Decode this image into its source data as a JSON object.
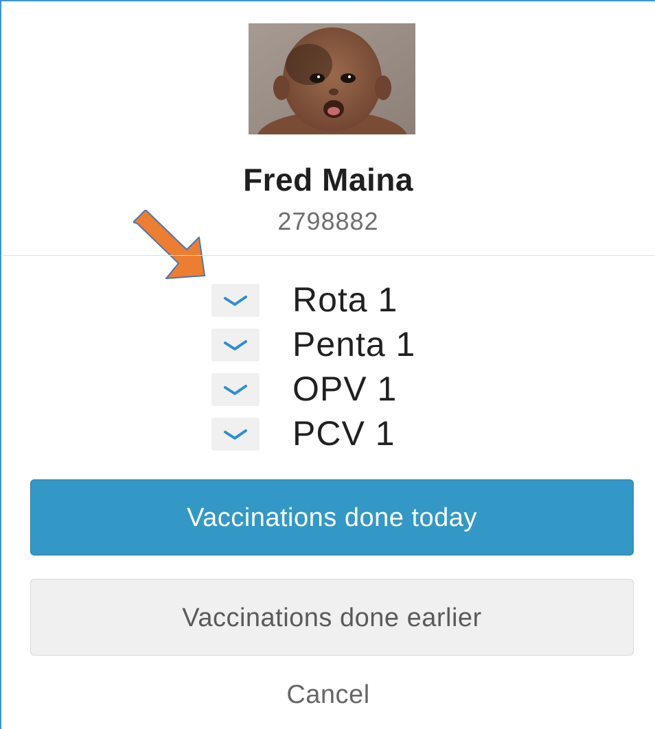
{
  "child": {
    "name": "Fred Maina",
    "id_number": "2798882"
  },
  "vaccines": [
    {
      "label": "Rota 1",
      "checked": true
    },
    {
      "label": "Penta 1",
      "checked": true
    },
    {
      "label": "OPV 1",
      "checked": true
    },
    {
      "label": "PCV 1",
      "checked": true
    }
  ],
  "actions": {
    "done_today": "Vaccinations done today",
    "done_earlier": "Vaccinations done earlier",
    "cancel": "Cancel"
  },
  "colors": {
    "primary_button": "#3398c6",
    "check_mark": "#2d8fd0",
    "annotation_arrow": "#ed7d31"
  }
}
